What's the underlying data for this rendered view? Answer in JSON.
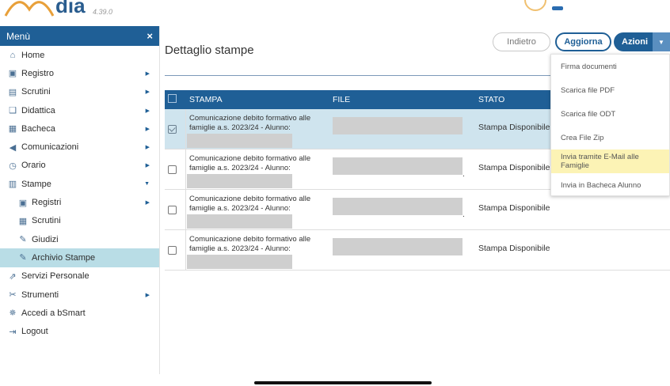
{
  "header": {
    "logo_text": "dia",
    "version": "4.39.0"
  },
  "sidebar": {
    "title": "Menù",
    "close_label": "×",
    "items": [
      {
        "label": "Home",
        "icon": "home-icon",
        "glyph": "⌂",
        "has_submenu": false
      },
      {
        "label": "Registro",
        "icon": "calendar-icon",
        "glyph": "▣",
        "has_submenu": true
      },
      {
        "label": "Scrutini",
        "icon": "document-icon",
        "glyph": "▤",
        "has_submenu": true
      },
      {
        "label": "Didattica",
        "icon": "book-icon",
        "glyph": "❑",
        "has_submenu": true
      },
      {
        "label": "Bacheca",
        "icon": "board-icon",
        "glyph": "▦",
        "has_submenu": true
      },
      {
        "label": "Comunicazioni",
        "icon": "megaphone-icon",
        "glyph": "◀",
        "has_submenu": true
      },
      {
        "label": "Orario",
        "icon": "clock-icon",
        "glyph": "◷",
        "has_submenu": true
      },
      {
        "label": "Stampe",
        "icon": "printer-icon",
        "glyph": "▥",
        "has_submenu": true,
        "expanded": true
      },
      {
        "label": "Registri",
        "icon": "calendar-icon",
        "glyph": "▣",
        "has_submenu": true,
        "sub": true
      },
      {
        "label": "Scrutini",
        "icon": "grid-icon",
        "glyph": "▦",
        "has_submenu": false,
        "sub": true
      },
      {
        "label": "Giudizi",
        "icon": "edit-icon",
        "glyph": "✎",
        "has_submenu": false,
        "sub": true
      },
      {
        "label": "Archivio Stampe",
        "icon": "edit-icon",
        "glyph": "✎",
        "has_submenu": false,
        "sub": true,
        "active": true
      },
      {
        "label": "Servizi Personale",
        "icon": "external-link-icon",
        "glyph": "⇗",
        "has_submenu": false
      },
      {
        "label": "Strumenti",
        "icon": "tools-icon",
        "glyph": "✂",
        "has_submenu": true
      },
      {
        "label": "Accedi a bSmart",
        "icon": "star-icon",
        "glyph": "✵",
        "has_submenu": false
      },
      {
        "label": "Logout",
        "icon": "logout-icon",
        "glyph": "⇥",
        "has_submenu": false
      }
    ]
  },
  "main": {
    "title": "Dettaglio stampe",
    "buttons": {
      "back": "Indietro",
      "refresh": "Aggiorna",
      "actions": "Azioni"
    },
    "table": {
      "headers": {
        "stampa": "STAMPA",
        "file": "FILE",
        "stato": "STATO"
      },
      "rows": [
        {
          "stampa": "Comunicazione debito formativo alle famiglie a.s. 2023/24 - Alunno:",
          "stato": "Stampa Disponibile",
          "checked": true,
          "dot": ""
        },
        {
          "stampa": "Comunicazione debito formativo alle famiglie a.s. 2023/24 - Alunno:",
          "stato": "Stampa Disponibile",
          "checked": false,
          "dot": "."
        },
        {
          "stampa": "Comunicazione debito formativo alle famiglie a.s. 2023/24 - Alunno:",
          "stato": "Stampa Disponibile",
          "checked": false,
          "dot": "."
        },
        {
          "stampa": "Comunicazione debito formativo alle famiglie a.s. 2023/24 - Alunno:",
          "stato": "Stampa Disponibile",
          "checked": false,
          "dot": ""
        }
      ]
    }
  },
  "actions_menu": {
    "items": [
      {
        "label": "Firma documenti"
      },
      {
        "label": "Scarica file PDF"
      },
      {
        "label": "Scarica file ODT"
      },
      {
        "label": "Crea File Zip"
      },
      {
        "label": "Invia tramite E-Mail alle Famiglie",
        "highlighted": true
      },
      {
        "label": "Invia in Bacheca Alunno"
      }
    ]
  },
  "colors": {
    "primary": "#1f5f96",
    "active_item": "#b9dde6",
    "selected_row": "#cfe4ee",
    "highlight": "#fcf3b5"
  }
}
